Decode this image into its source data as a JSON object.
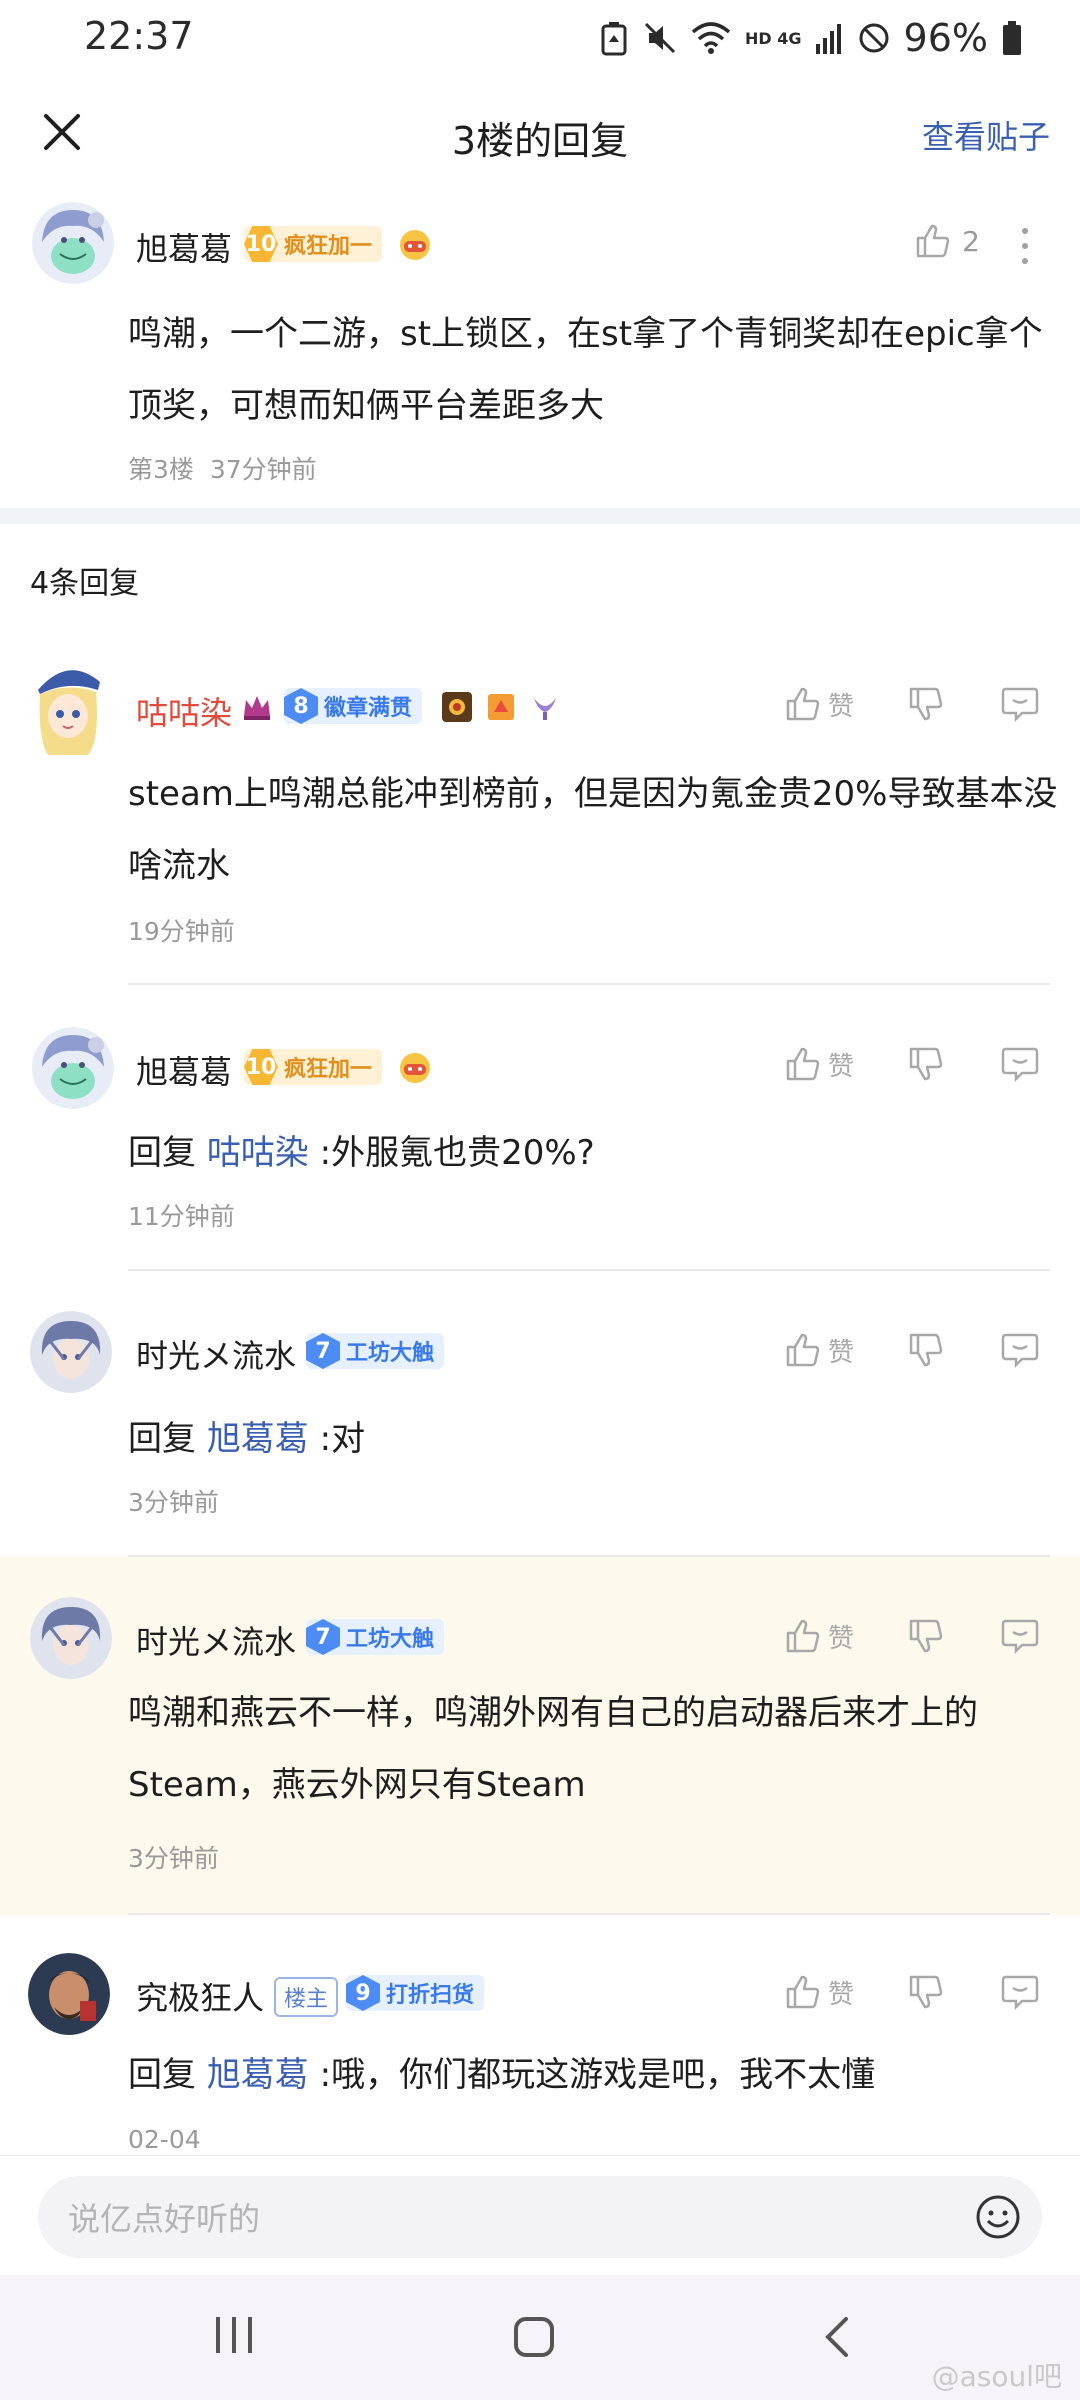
{
  "status_bar": {
    "time": "22:37",
    "network": "HD 4G",
    "battery": "96%"
  },
  "header": {
    "title": "3楼的回复",
    "view_post": "查看贴子"
  },
  "main_post": {
    "username": "旭葛葛",
    "level": "10",
    "level_title": "疯狂加一",
    "like_count": "2",
    "text": "鸣潮，一个二游，st上锁区，在st拿了个青铜奖却在epic拿个顶奖，可想而知俩平台差距多大",
    "floor": "第3楼",
    "time": "37分钟前"
  },
  "reply_count": "4条回复",
  "action_labels": {
    "like": "赞"
  },
  "replies": [
    {
      "username": "咕咕染",
      "level": "8",
      "level_title": "徽章满贯",
      "text": "steam上鸣潮总能冲到榜前，但是因为氪金贵20%导致基本没啥流水",
      "time": "19分钟前"
    },
    {
      "username": "旭葛葛",
      "level": "10",
      "level_title": "疯狂加一",
      "reply_prefix": "回复",
      "reply_to": "咕咕染",
      "text": ":外服氪也贵20%?",
      "time": "11分钟前"
    },
    {
      "username": "时光メ流水",
      "level": "7",
      "level_title": "工坊大触",
      "reply_prefix": "回复",
      "reply_to": "旭葛葛",
      "text": ":对",
      "time": "3分钟前"
    },
    {
      "username": "时光メ流水",
      "level": "7",
      "level_title": "工坊大触",
      "text": "鸣潮和燕云不一样，鸣潮外网有自己的启动器后来才上的Steam，燕云外网只有Steam",
      "time": "3分钟前"
    },
    {
      "username": "究极狂人",
      "host_tag": "楼主",
      "level": "9",
      "level_title": "打折扫货",
      "reply_prefix": "回复",
      "reply_to": "旭葛葛",
      "text": ":哦，你们都玩这游戏是吧，我不太懂",
      "time": "02-04"
    }
  ],
  "input": {
    "placeholder": "说亿点好听的"
  },
  "watermark": "@asoul吧",
  "colors": {
    "link_blue": "#3a5fb0",
    "highlight_bg": "#fdf9ec",
    "red_name": "#e24a3b",
    "meta_gray": "#9a9a9a"
  }
}
